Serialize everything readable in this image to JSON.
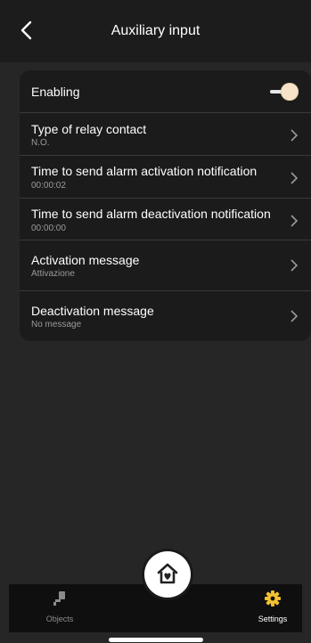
{
  "header": {
    "title": "Auxiliary input",
    "back_icon": "chevron-left-icon"
  },
  "settings": {
    "enabling": {
      "label": "Enabling",
      "enabled": true
    },
    "items": [
      {
        "label": "Type of relay contact",
        "value": "N.O."
      },
      {
        "label": "Time to send alarm activation notification",
        "value": "00:00:02"
      },
      {
        "label": "Time to send alarm deactivation notification",
        "value": "00:00:00"
      },
      {
        "label": "Activation message",
        "value": "Attivazione"
      },
      {
        "label": "Deactivation message",
        "value": "No message"
      }
    ]
  },
  "tabbar": {
    "objects": {
      "label": "Objects",
      "icon": "plug-icon"
    },
    "home": {
      "icon": "home-heart-icon"
    },
    "settings": {
      "label": "Settings",
      "icon": "gear-icon"
    }
  },
  "colors": {
    "accent": "#f2c230",
    "background": "#262626",
    "card": "#1b1b1b",
    "toggle_knob": "#f6e3c8"
  }
}
